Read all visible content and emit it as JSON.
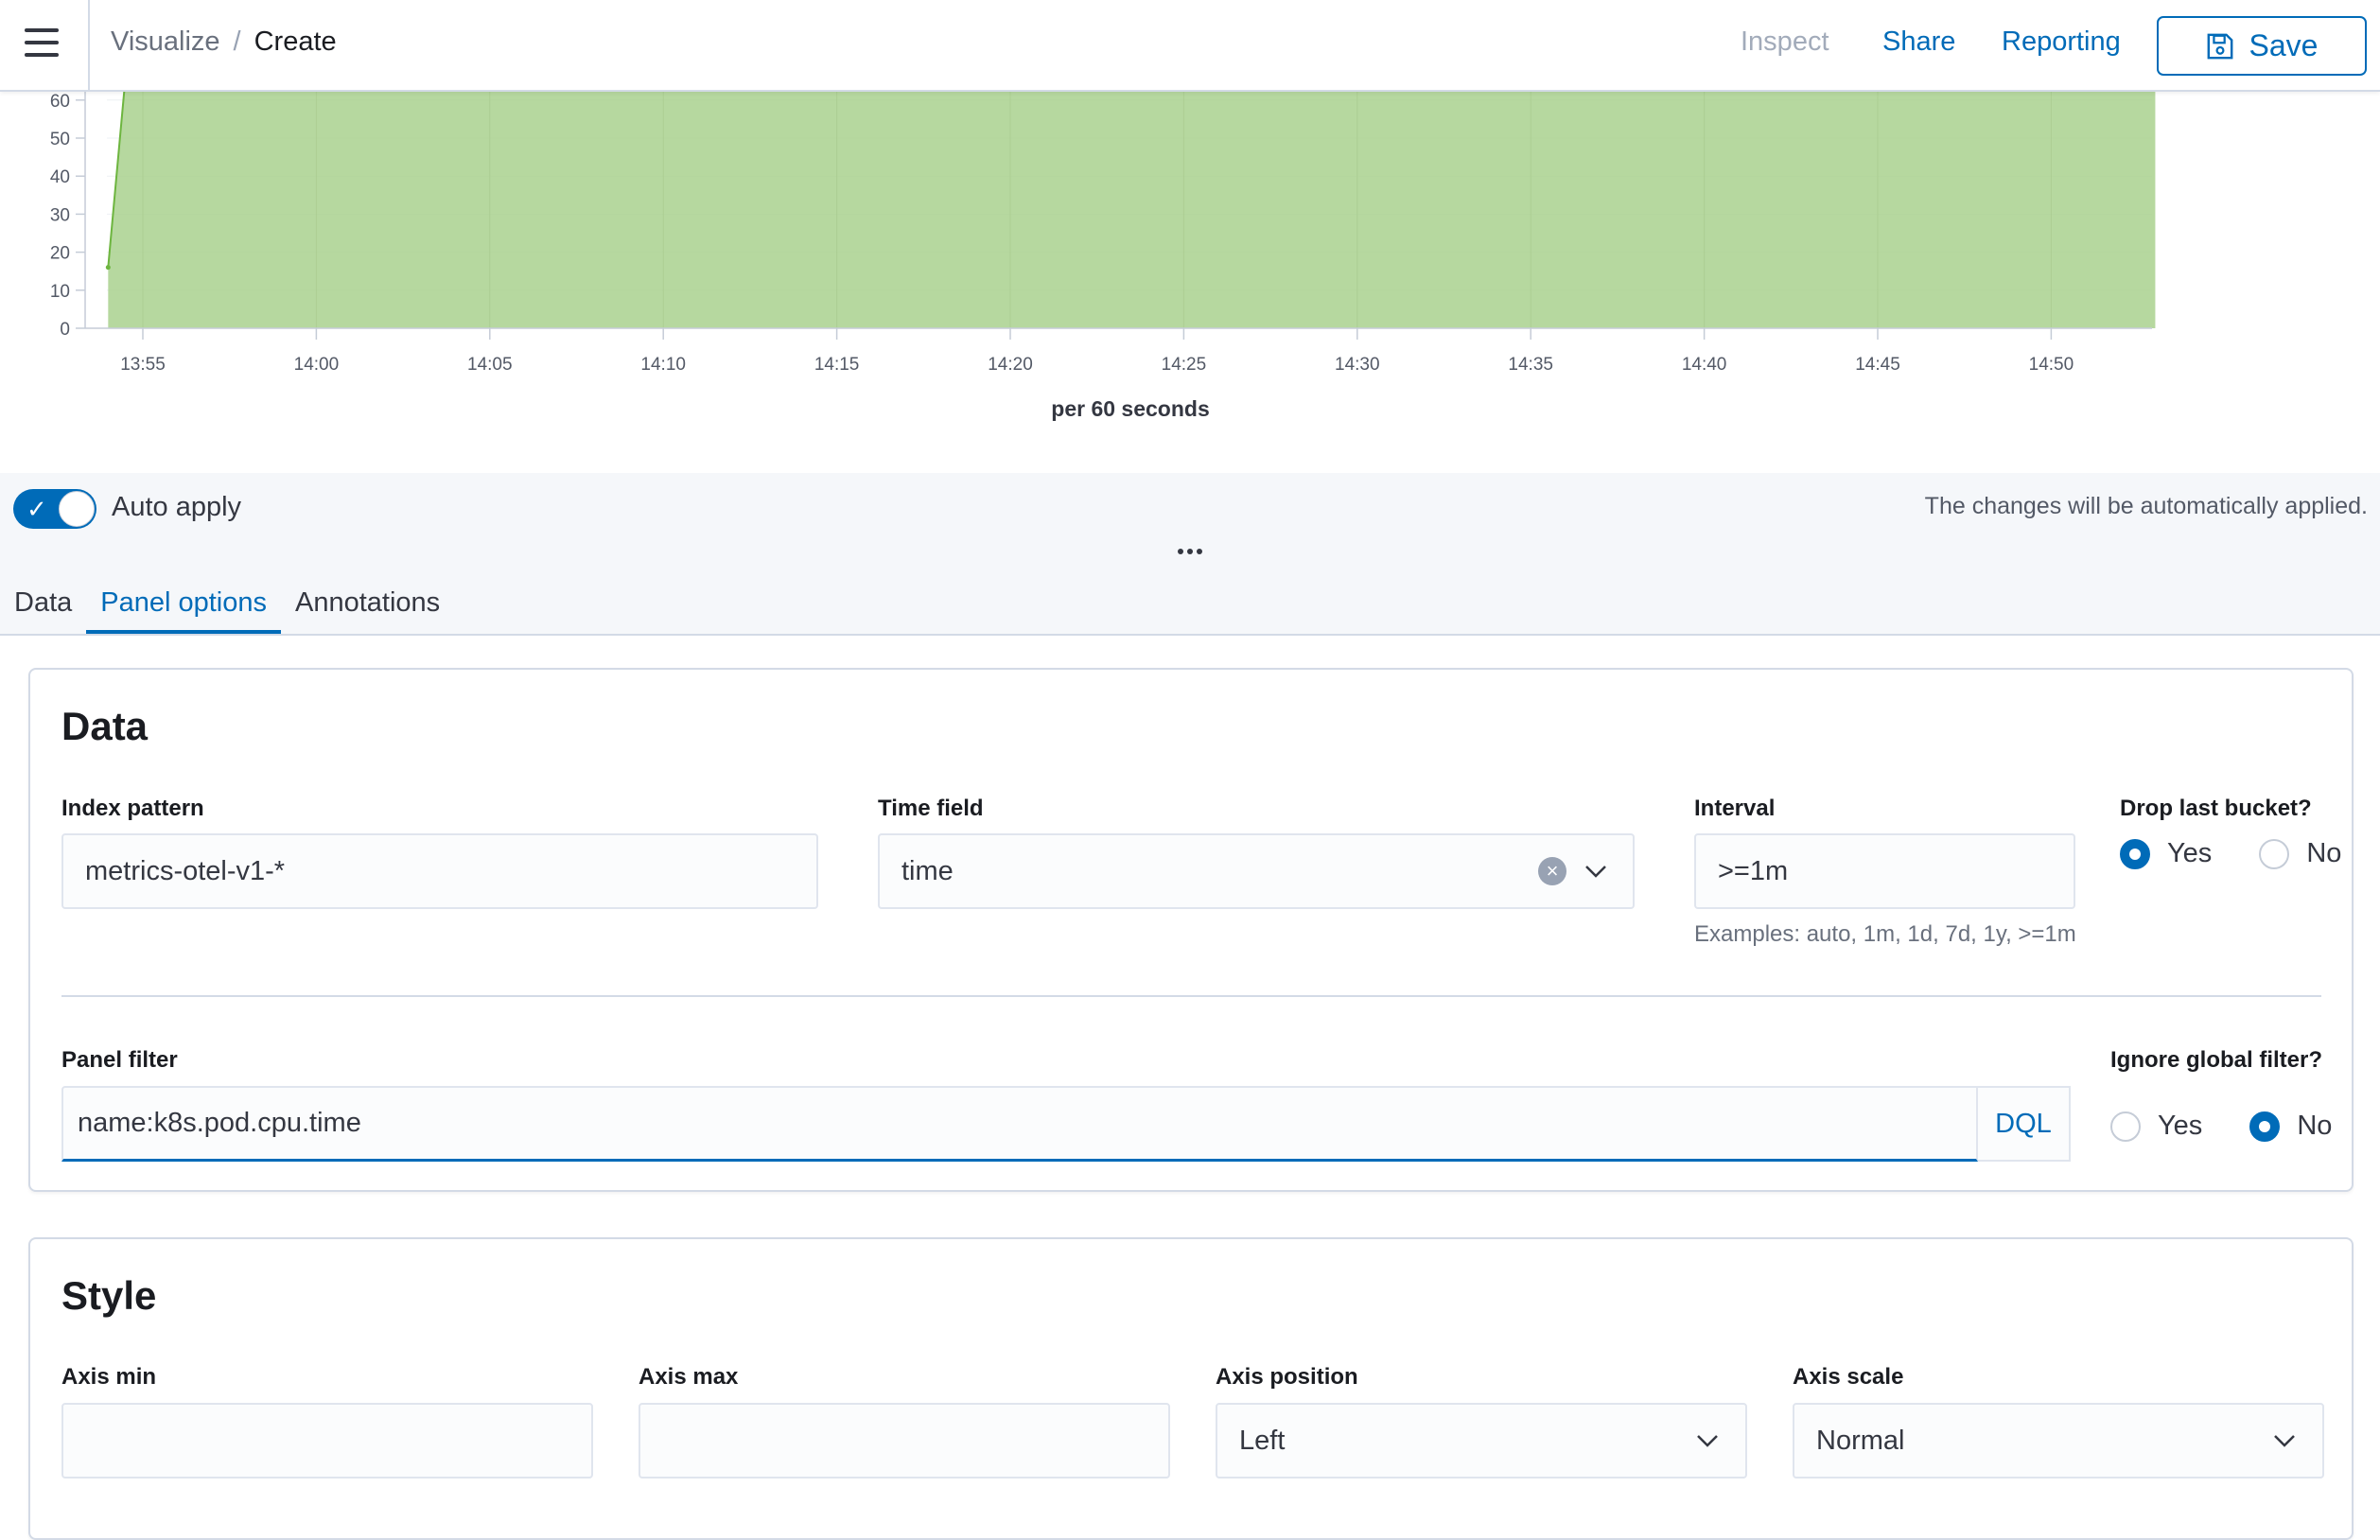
{
  "header": {
    "breadcrumbs": [
      "Visualize",
      "Create"
    ],
    "inspect_label": "Inspect",
    "share_label": "Share",
    "reporting_label": "Reporting",
    "save_label": "Save"
  },
  "chart_data": {
    "type": "area",
    "x": [
      "13:54",
      "13:55",
      "14:00",
      "14:05",
      "14:10",
      "14:15",
      "14:20",
      "14:25",
      "14:30",
      "14:35",
      "14:40",
      "14:45",
      "14:50",
      "14:53"
    ],
    "y_axis_ticks": [
      0,
      10,
      20,
      30,
      40,
      50,
      60
    ],
    "x_axis_ticks": [
      "13:55",
      "14:00",
      "14:05",
      "14:10",
      "14:15",
      "14:20",
      "14:25",
      "14:30",
      "14:35",
      "14:40",
      "14:45",
      "14:50"
    ],
    "series": [
      {
        "color": "#a9d18e",
        "stroke": "#6db53f",
        "points": [
          [
            "13:54",
            16
          ],
          [
            "13:54.5",
            66
          ],
          [
            "14:53",
            66
          ]
        ]
      }
    ],
    "xlabel": "per 60 seconds",
    "ylim_visible": [
      0,
      60
    ],
    "grid": true
  },
  "apply_bar": {
    "toggle_label": "Auto apply",
    "toggle_on": true,
    "hint": "The changes will be automatically applied."
  },
  "tabs": [
    {
      "label": "Data",
      "active": false
    },
    {
      "label": "Panel options",
      "active": true
    },
    {
      "label": "Annotations",
      "active": false
    }
  ],
  "data_panel": {
    "title": "Data",
    "index_pattern": {
      "label": "Index pattern",
      "value": "metrics-otel-v1-*"
    },
    "time_field": {
      "label": "Time field",
      "value": "time"
    },
    "interval": {
      "label": "Interval",
      "value": ">=1m",
      "help": "Examples: auto, 1m, 1d, 7d, 1y, >=1m"
    },
    "drop_last_bucket": {
      "label": "Drop last bucket?",
      "yes": "Yes",
      "no": "No",
      "selected": "Yes"
    },
    "panel_filter": {
      "label": "Panel filter",
      "value": "name:k8s.pod.cpu.time",
      "language": "DQL"
    },
    "ignore_global_filter": {
      "label": "Ignore global filter?",
      "yes": "Yes",
      "no": "No",
      "selected": "No"
    }
  },
  "style_panel": {
    "title": "Style",
    "axis_min": {
      "label": "Axis min",
      "value": ""
    },
    "axis_max": {
      "label": "Axis max",
      "value": ""
    },
    "axis_position": {
      "label": "Axis position",
      "value": "Left"
    },
    "axis_scale": {
      "label": "Axis scale",
      "value": "Normal"
    }
  },
  "colors": {
    "accent": "#006bb8",
    "area_fill": "#a9d18e",
    "area_stroke": "#6db53f"
  }
}
